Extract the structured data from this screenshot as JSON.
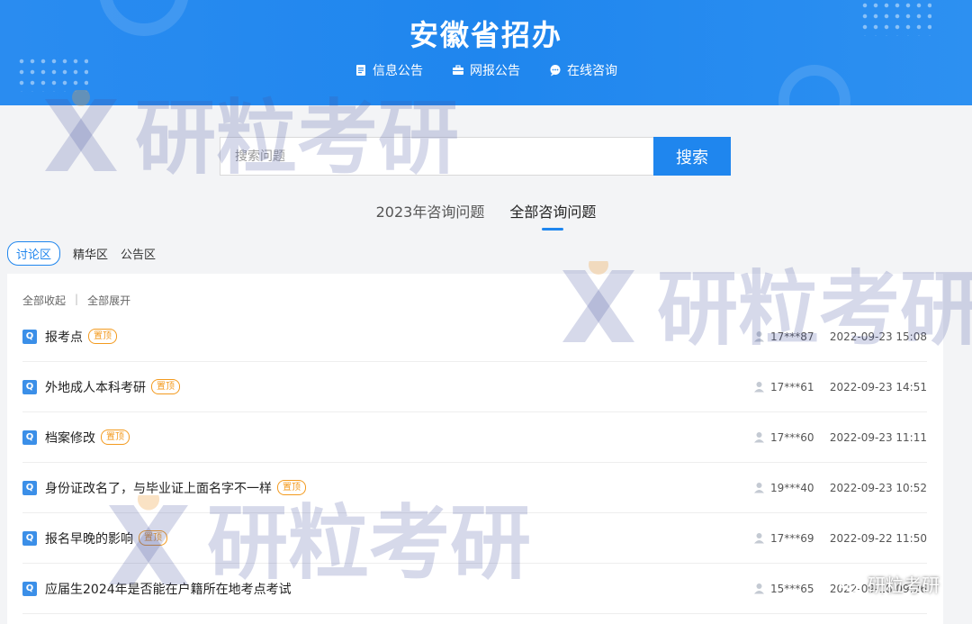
{
  "header": {
    "title": "安徽省招办",
    "nav": [
      {
        "label": "信息公告",
        "icon": "document-icon"
      },
      {
        "label": "网报公告",
        "icon": "briefcase-icon"
      },
      {
        "label": "在线咨询",
        "icon": "chat-bubble-icon"
      }
    ]
  },
  "search": {
    "placeholder": "搜索问题",
    "button_label": "搜索"
  },
  "tabs": [
    {
      "label": "2023年咨询问题",
      "active": false
    },
    {
      "label": "全部咨询问题",
      "active": true
    }
  ],
  "zones": [
    {
      "label": "讨论区",
      "active": true
    },
    {
      "label": "精华区",
      "active": false
    },
    {
      "label": "公告区",
      "active": false
    }
  ],
  "list_controls": {
    "collapse_all": "全部收起",
    "separator": "|",
    "expand_all": "全部展开"
  },
  "questions": [
    {
      "icon_text": "Q",
      "title": "报考点",
      "tag": "置顶",
      "user": "17***87",
      "time": "2022-09-23 15:08"
    },
    {
      "icon_text": "Q",
      "title": "外地成人本科考研",
      "tag": "置顶",
      "user": "17***61",
      "time": "2022-09-23 14:51"
    },
    {
      "icon_text": "Q",
      "title": "档案修改",
      "tag": "置顶",
      "user": "17***60",
      "time": "2022-09-23 11:11"
    },
    {
      "icon_text": "Q",
      "title": "身份证改名了，与毕业证上面名字不一样",
      "tag": "置顶",
      "user": "19***40",
      "time": "2022-09-23 10:52"
    },
    {
      "icon_text": "Q",
      "title": "报名早晚的影响",
      "tag": "置顶",
      "user": "17***69",
      "time": "2022-09-22 11:50"
    },
    {
      "icon_text": "Q",
      "title": "应届生2024年是否能在户籍所在地考点考试",
      "tag": "",
      "user": "15***65",
      "time": "2022-09-18 09:26"
    }
  ],
  "watermark_text": "研粒考研",
  "credit_text": "研粒考研",
  "colors": {
    "primary": "#1f86ee",
    "tag": "#f39a1e",
    "watermark": "#5060b0"
  }
}
